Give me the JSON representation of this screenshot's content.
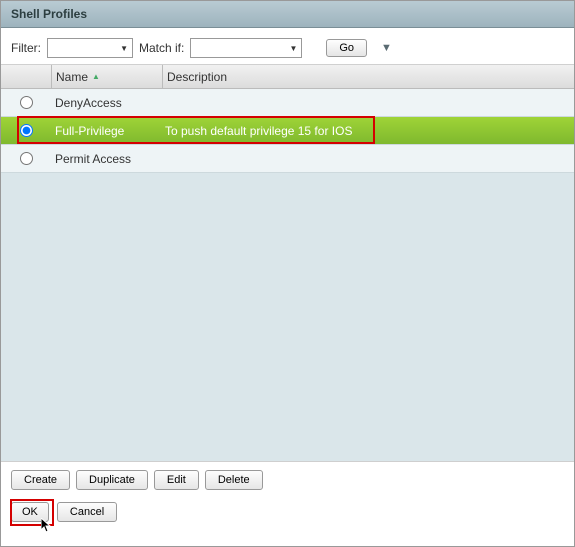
{
  "panel": {
    "title": "Shell Profiles"
  },
  "filter": {
    "label": "Filter:",
    "match_label": "Match if:",
    "go": "Go"
  },
  "columns": {
    "name": "Name",
    "desc": "Description"
  },
  "rows": [
    {
      "name": "DenyAccess",
      "desc": "",
      "selected": false
    },
    {
      "name": "Full-Privilege",
      "desc": "To push default privilege 15 for IOS",
      "selected": true
    },
    {
      "name": "Permit Access",
      "desc": "",
      "selected": false
    }
  ],
  "buttons": {
    "create": "Create",
    "duplicate": "Duplicate",
    "edit": "Edit",
    "delete": "Delete"
  },
  "footer": {
    "ok": "OK",
    "cancel": "Cancel"
  }
}
